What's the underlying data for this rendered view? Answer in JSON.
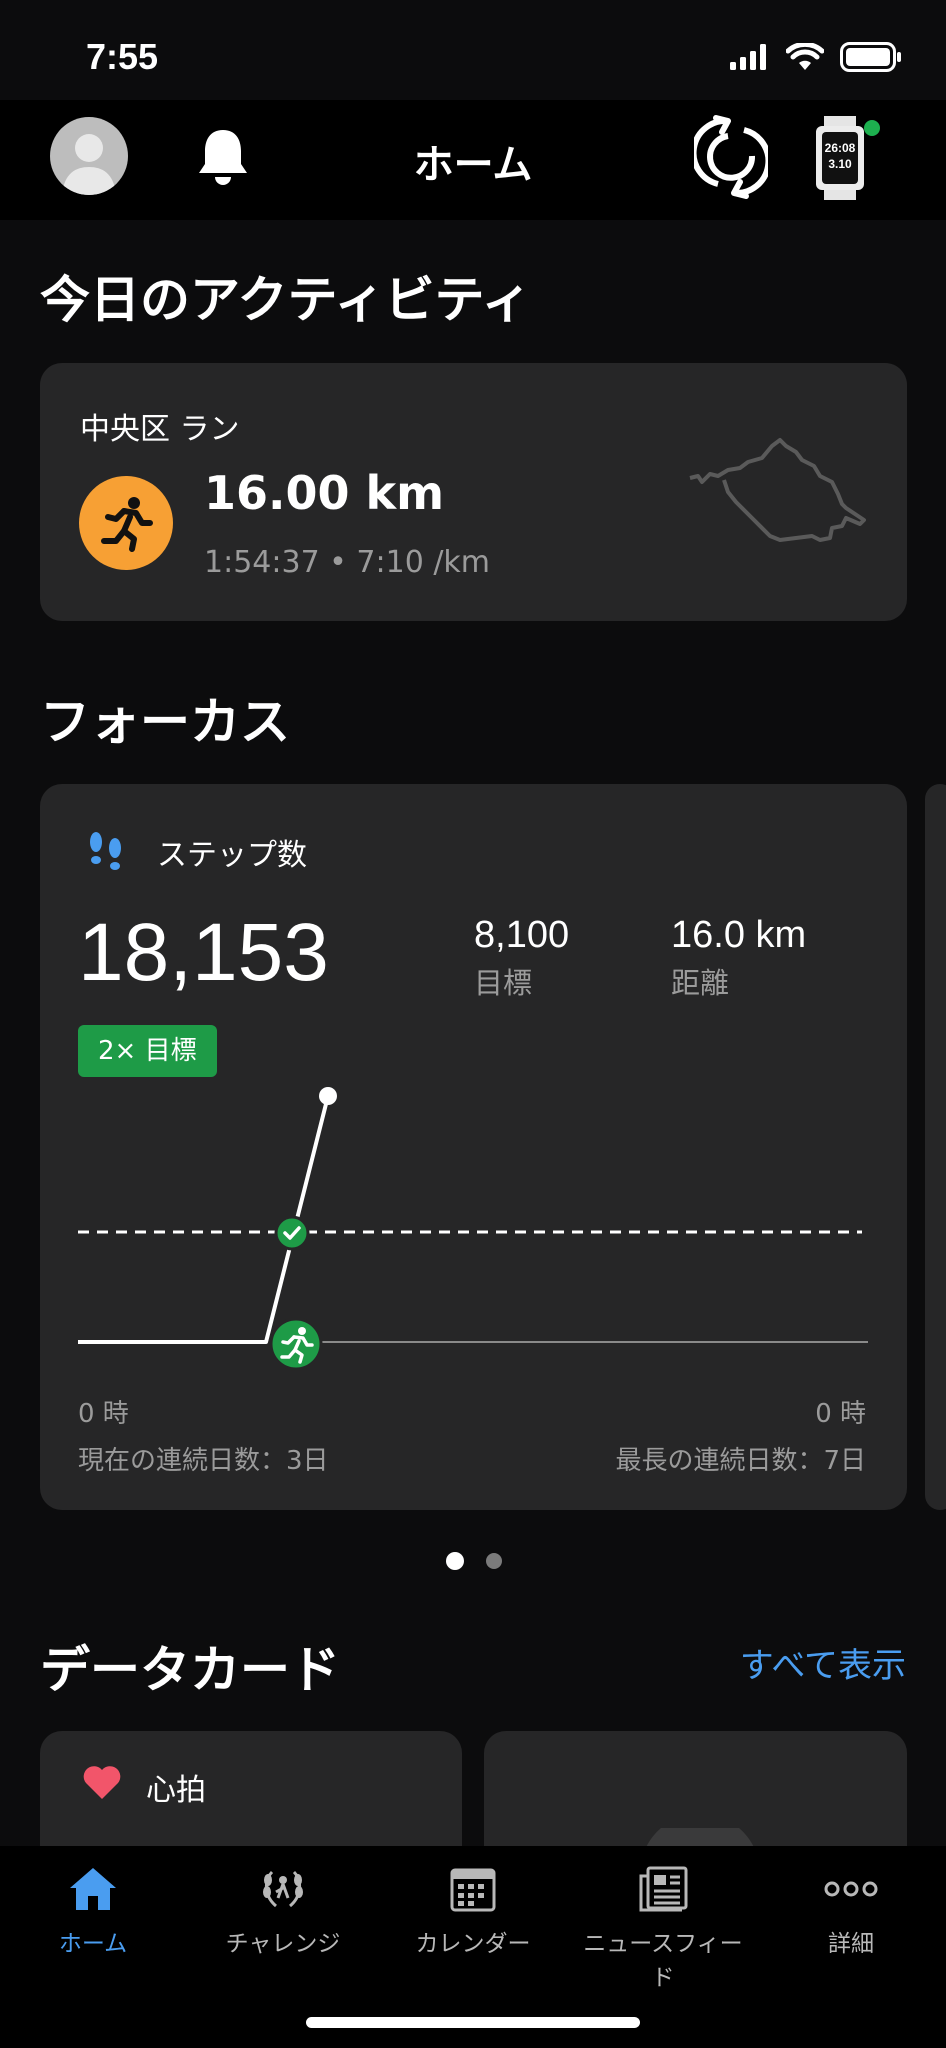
{
  "status": {
    "time": "7:55"
  },
  "header": {
    "title": "ホーム"
  },
  "watch": {
    "time": "26:08",
    "date": "3.10"
  },
  "today": {
    "section_title": "今日のアクティビティ",
    "activity_name": "中央区 ラン",
    "distance": "16.00 km",
    "detail": "1:54:37 • 7:10 /km"
  },
  "focus": {
    "section_title": "フォーカス",
    "label": "ステップ数",
    "steps": "18,153",
    "goal_value": "8,100",
    "goal_label": "目標",
    "distance_value": "16.0 km",
    "distance_label": "距離",
    "badge": "2× 目標",
    "axis_start": "0 時",
    "axis_end": "0 時",
    "streak_current": "現在の連続日数：3日",
    "streak_longest": "最長の連続日数：7日"
  },
  "datacards": {
    "section_title": "データカード",
    "show_all": "すべて表示",
    "heart_label": "心拍"
  },
  "tabs": [
    {
      "label": "ホーム",
      "icon": "home-icon"
    },
    {
      "label": "チャレンジ",
      "icon": "laurel-icon"
    },
    {
      "label": "カレンダー",
      "icon": "calendar-icon"
    },
    {
      "label": "ニュースフィード",
      "icon": "newspaper-icon"
    },
    {
      "label": "詳細",
      "icon": "more-icon"
    }
  ],
  "colors": {
    "accent": "#4a9df0",
    "run": "#f7a034",
    "success": "#1e9b47",
    "card": "#262627"
  }
}
